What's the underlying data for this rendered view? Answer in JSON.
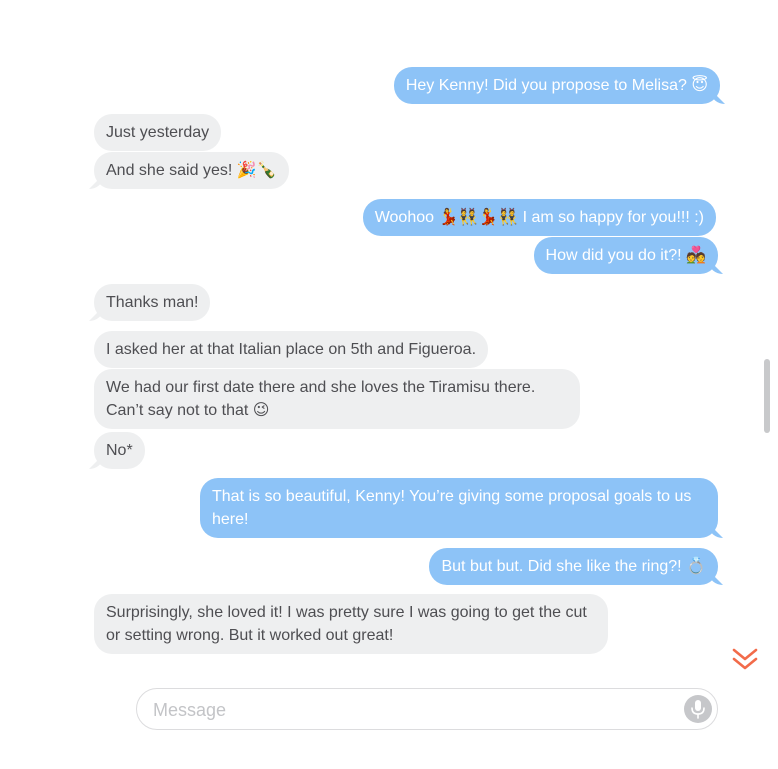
{
  "messages": [
    {
      "dir": "out",
      "text": "Hey Kenny! Did you propose to Melisa? 😇"
    },
    {
      "dir": "in",
      "text": "Just yesterday"
    },
    {
      "dir": "in",
      "text": "And she said yes! 🎉🍾"
    },
    {
      "dir": "out",
      "text": "Woohoo 💃👯💃👯 I am so happy for you!!! :)"
    },
    {
      "dir": "out",
      "text": "How did you do it?! 💑"
    },
    {
      "dir": "in",
      "text": "Thanks man!"
    },
    {
      "dir": "in",
      "text": "I asked her at that Italian place on 5th and Figueroa."
    },
    {
      "dir": "in",
      "text": "We had our first date there and she loves the Tiramisu there. Can’t say not to that 😉"
    },
    {
      "dir": "in",
      "text": "No*"
    },
    {
      "dir": "out",
      "text": "That is so beautiful, Kenny! You’re giving some proposal goals to us here!"
    },
    {
      "dir": "out",
      "text": "But but but. Did she like the ring?! 💍"
    },
    {
      "dir": "in",
      "text": "Surprisingly, she loved it! I was pretty sure I was going to get the cut or setting wrong. But it worked out great!"
    }
  ],
  "composer": {
    "placeholder": "Message",
    "mic_icon": "microphone-icon"
  },
  "scroll_down_icon": "double-chevron-down-icon",
  "colors": {
    "incoming_bubble": "#eeeff0",
    "incoming_text": "#4e4e52",
    "outgoing_bubble": "#8dc3f7",
    "outgoing_text": "#ffffff",
    "scroll_down_accent": "#f26b4a"
  }
}
